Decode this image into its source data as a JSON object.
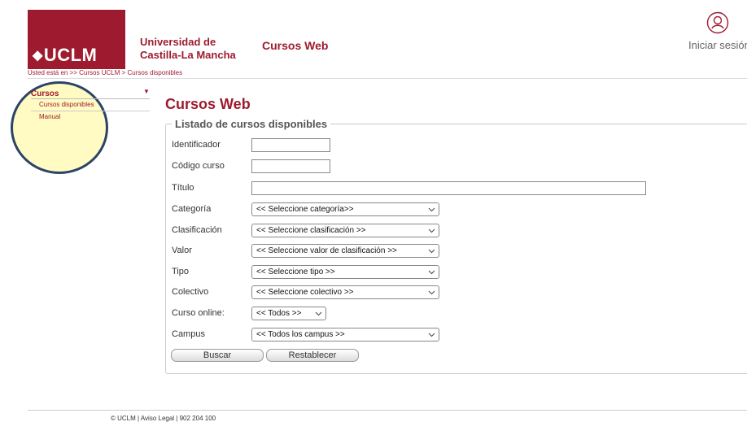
{
  "header": {
    "logo_text": "UCLM",
    "university_line1": "Universidad de",
    "university_line2": "Castilla-La Mancha",
    "app_title": "Cursos Web",
    "login_label": "Iniciar sesión",
    "brand_color": "#9e1b2f"
  },
  "breadcrumb": "Usted está en >> Cursos UCLM  > Cursos disponibles",
  "sidebar": {
    "title": "Cursos",
    "items": [
      {
        "label": "Cursos disponibles"
      },
      {
        "label": "Manual"
      }
    ]
  },
  "main": {
    "title": "Cursos Web",
    "legend": "Listado de cursos disponibles",
    "fields": {
      "identificador": {
        "label": "Identificador",
        "value": ""
      },
      "codigo": {
        "label": "Código curso",
        "value": ""
      },
      "titulo": {
        "label": "Título",
        "value": ""
      },
      "categoria": {
        "label": "Categoría",
        "selected": "<< Seleccione categoría>>"
      },
      "clasificacion": {
        "label": "Clasificación",
        "selected": "<< Seleccione clasificación >>"
      },
      "valor": {
        "label": "Valor",
        "selected": "<< Seleccione valor de clasificación >>"
      },
      "tipo": {
        "label": "Tipo",
        "selected": "<< Seleccione tipo >>"
      },
      "colectivo": {
        "label": "Colectivo",
        "selected": "<< Seleccione colectivo >>"
      },
      "online": {
        "label": "Curso online:",
        "selected": "<< Todos >>"
      },
      "campus": {
        "label": "Campus",
        "selected": "<< Todos los campus >>"
      }
    },
    "buttons": {
      "search": "Buscar",
      "reset": "Restablecer"
    }
  },
  "footer": "© UCLM | Aviso Legal | 902 204 100"
}
